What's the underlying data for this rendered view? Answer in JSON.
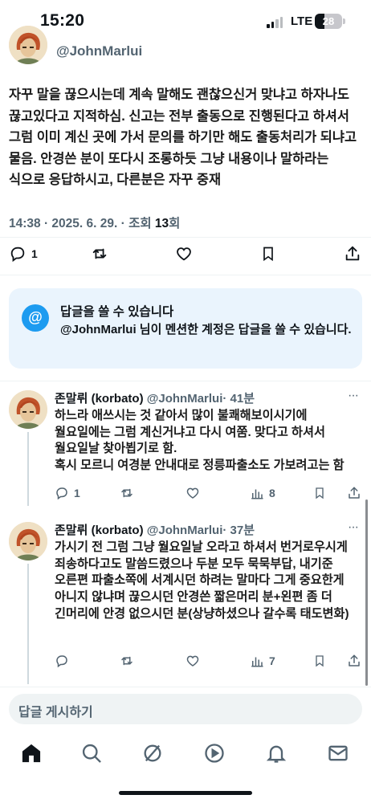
{
  "status_bar": {
    "time": "15:20",
    "network": "LTE",
    "battery": "28"
  },
  "main_tweet": {
    "handle": "@JohnMarlui",
    "text": "자꾸 말을 끊으시는데 계속 말해도 괜찮으신거 맞냐고 하자나도 끊고있다고 지적하심. 신고는 전부 출동으로 진행된다고 하셔서 그럼 이미 계신 곳에 가서 문의를 하기만 해도 출동처리가 되냐고 물음. 안경쓴 분이 또다시 조롱하듯 그냥 내용이나 말하라는 식으로 응답하시고, 다른분은 자꾸 중재",
    "meta_time": "14:38 · 2025. 6. 29. · 조회 ",
    "meta_views": "13",
    "meta_suffix": "회",
    "reply_count": "1"
  },
  "notice": {
    "icon": "@",
    "title": "답글을 쓸 수 있습니다",
    "handle": "@JohnMarlui",
    "body": " 님이 멘션한 계정은 답글을 쓸 수 있습니다."
  },
  "replies": [
    {
      "name": "존말뤼 (korbato)",
      "handle": "@JohnMarlui",
      "time": "· 41분",
      "text": "하느라 애쓰시는 것 같아서 많이 불쾌해보이시기에 월요일에는 그럼 계신거냐고 다시 여쭘. 맞다고 하셔서 월요일날 찾아뵙기로 함.\n혹시 모르니 여경분 안내대로 정릉파출소도 가보려고는 함",
      "reply_count": "1",
      "views": "8"
    },
    {
      "name": "존말뤼 (korbato)",
      "handle": "@JohnMarlui",
      "time": "· 37분",
      "text": "가시기 전 그럼 그냥 월요일날 오라고 하셔서 번거로우시게 죄송하다고도 말씀드렸으나 두분 모두 묵묵부답, 내기준 오른편 파출소쪽에 서계시던 하려는 말마다 그게 중요한게 아니지 않냐며 끊으시던 안경쓴 짧은머리 분+왼편 좀 더 긴머리에 안경 없으시던 분(상냥하셨으나 갈수록 태도변화)",
      "reply_count": "",
      "views": "7"
    }
  ],
  "compose": {
    "placeholder": "답글 게시하기"
  },
  "colors": {
    "accent": "#1d9bf0",
    "muted": "#536471",
    "notice_bg": "#eaf4fd"
  }
}
